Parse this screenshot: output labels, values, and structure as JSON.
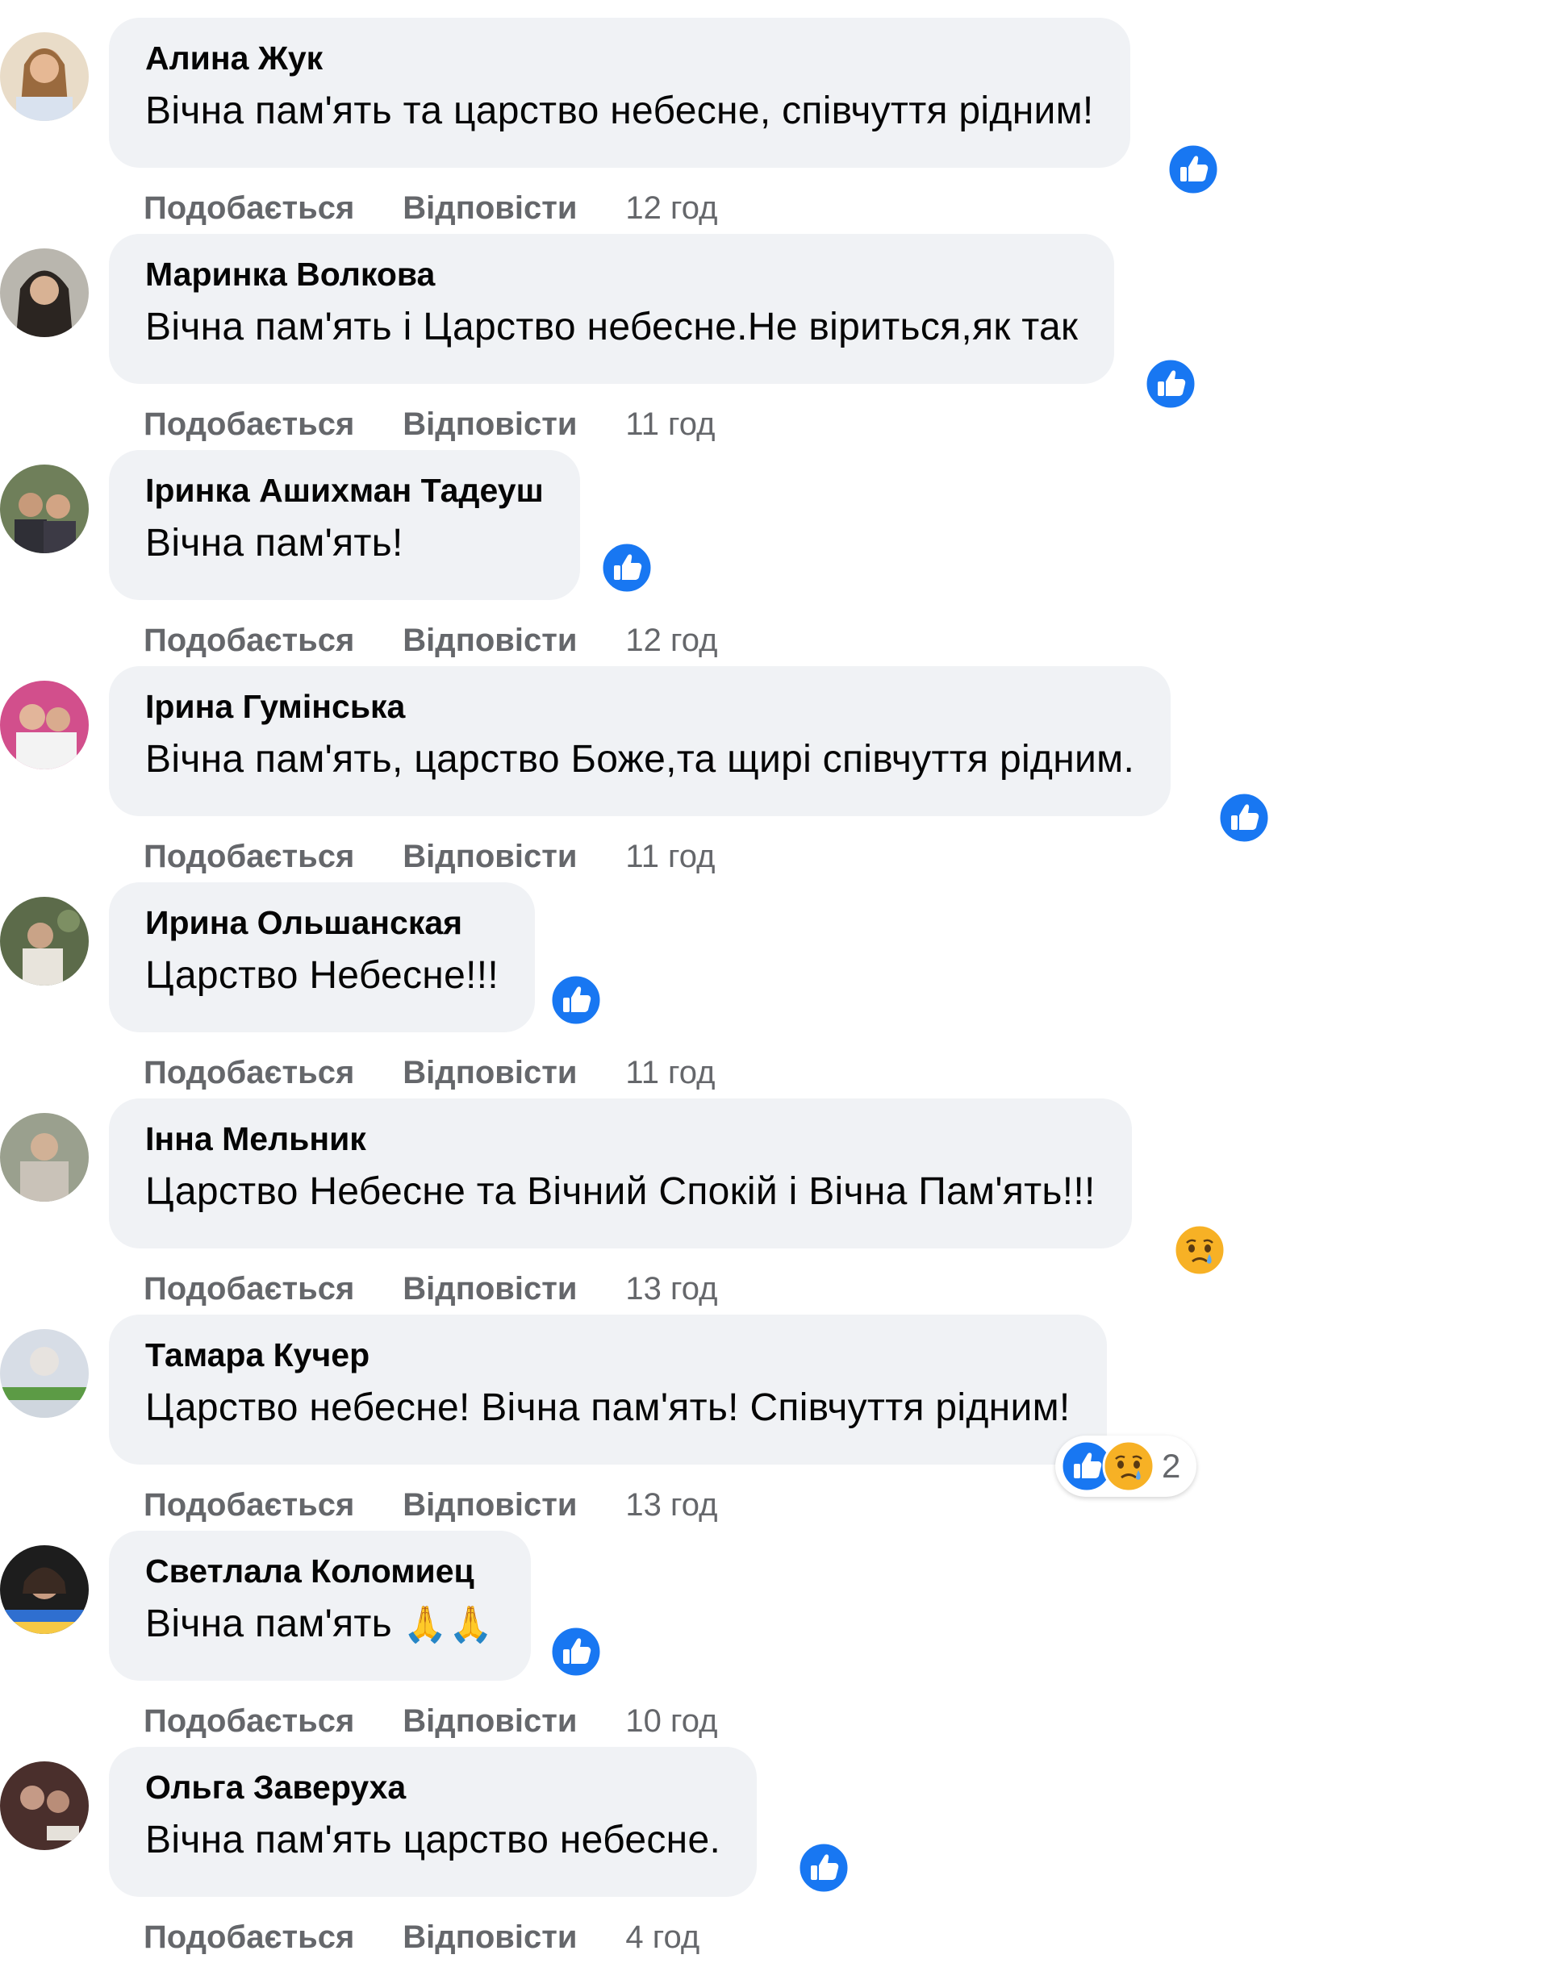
{
  "colors": {
    "like_blue": "#1877f2",
    "bubble_bg": "#f0f2f5",
    "meta_gray": "#65676b",
    "text": "#050505"
  },
  "icons": {
    "like": "like-reaction-icon",
    "sad": "sad-reaction-icon"
  },
  "comments": [
    {
      "author": "Алина Жук",
      "text": "Вічна пам'ять та царство небесне, співчуття рідним!",
      "like": "Подобається",
      "reply": "Відповісти",
      "time": "12 год",
      "reactions": [
        "like"
      ]
    },
    {
      "author": "Маринка Волкова",
      "text": "Вічна пам'ять і Царство небесне.Не віриться,як так",
      "like": "Подобається",
      "reply": "Відповісти",
      "time": "11 год",
      "reactions": [
        "like"
      ]
    },
    {
      "author": "Іринка Ашихман Тадеуш",
      "text": "Вічна пам'ять!",
      "like": "Подобається",
      "reply": "Відповісти",
      "time": "12 год",
      "reactions": [
        "like"
      ]
    },
    {
      "author": "Ірина Гумінська",
      "text": "Вічна пам'ять, царство Боже,та щирі співчуття рідним.",
      "like": "Подобається",
      "reply": "Відповісти",
      "time": "11 год",
      "reactions": [
        "like"
      ]
    },
    {
      "author": "Ирина Ольшанская",
      "text": "Царство Небесне!!!",
      "like": "Подобається",
      "reply": "Відповісти",
      "time": "11 год",
      "reactions": [
        "like"
      ]
    },
    {
      "author": "Інна Мельник",
      "text": "Царство Небесне та Вічний Спокій і Вічна Пам'ять!!!",
      "like": "Подобається",
      "reply": "Відповісти",
      "time": "13 год",
      "reactions": [
        "sad"
      ]
    },
    {
      "author": "Тамара Кучер",
      "text": "Царство небесне! Вічна пам'ять! Співчуття рідним!",
      "like": "Подобається",
      "reply": "Відповісти",
      "time": "13 год",
      "reactions": [
        "like",
        "sad"
      ],
      "reaction_count": "2"
    },
    {
      "author": "Светлала Коломиец",
      "text": "Вічна пам'ять",
      "emoji": "🙏🙏",
      "like": "Подобається",
      "reply": "Відповісти",
      "time": "10 год",
      "reactions": [
        "like"
      ]
    },
    {
      "author": "Ольга Заверуха",
      "text": "Вічна пам'ять царство небесне.",
      "like": "Подобається",
      "reply": "Відповісти",
      "time": "4 год",
      "reactions": [
        "like"
      ]
    }
  ]
}
